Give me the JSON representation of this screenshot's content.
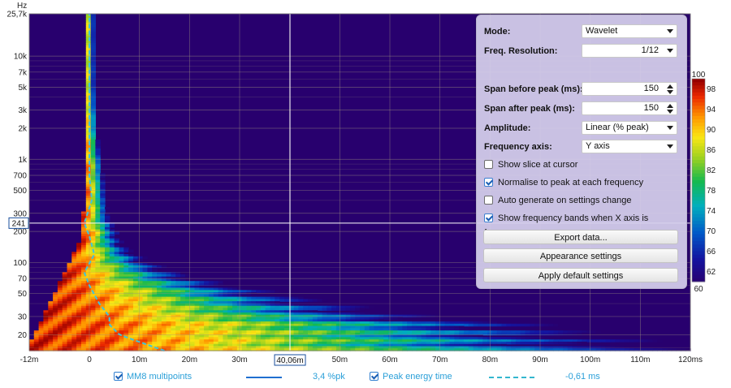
{
  "chart_data": {
    "type": "heatmap",
    "xlabel": "",
    "x_unit": "ms",
    "xlim": [
      -12,
      120
    ],
    "x_ticks": [
      "-12m",
      "0",
      "10m",
      "20m",
      "30m",
      "40m",
      "50m",
      "60m",
      "70m",
      "80m",
      "90m",
      "100m",
      "110m",
      "120ms"
    ],
    "x_tick_values": [
      -12,
      0,
      10,
      20,
      30,
      40,
      50,
      60,
      70,
      80,
      90,
      100,
      110,
      120
    ],
    "ylabel": "Hz",
    "y_scale": "log",
    "ylim": [
      14,
      25700
    ],
    "y_ticks": [
      "25,7k",
      "10k",
      "7k",
      "5k",
      "3k",
      "2k",
      "1k",
      "700",
      "500",
      "300",
      "200",
      "100",
      "70",
      "50",
      "30",
      "20"
    ],
    "y_tick_values": [
      25700,
      10000,
      7000,
      5000,
      3000,
      2000,
      1000,
      700,
      500,
      300,
      200,
      100,
      70,
      50,
      30,
      20
    ],
    "cursor": {
      "x_label": "40,06m",
      "x_value": 40.06,
      "y_label": "241",
      "y_value": 241
    },
    "colorbar": {
      "min": 60,
      "max": 100,
      "ticks": [
        100,
        98,
        94,
        90,
        86,
        82,
        78,
        74,
        70,
        66,
        62,
        60
      ]
    },
    "decay_end_ms": [
      {
        "f": 15,
        "t": 120
      },
      {
        "f": 20,
        "t": 108
      },
      {
        "f": 25,
        "t": 95
      },
      {
        "f": 30,
        "t": 70
      },
      {
        "f": 40,
        "t": 52
      },
      {
        "f": 50,
        "t": 40
      },
      {
        "f": 70,
        "t": 22
      },
      {
        "f": 100,
        "t": 12
      },
      {
        "f": 150,
        "t": 6
      },
      {
        "f": 200,
        "t": 5
      },
      {
        "f": 300,
        "t": 3
      },
      {
        "f": 500,
        "t": 2.5
      },
      {
        "f": 1000,
        "t": 1.5
      },
      {
        "f": 2000,
        "t": 0.5
      },
      {
        "f": 5000,
        "t": 0
      }
    ],
    "peak_energy_time": [
      {
        "f": 14,
        "t": 15
      },
      {
        "f": 17,
        "t": 10
      },
      {
        "f": 20,
        "t": 6
      },
      {
        "f": 25,
        "t": 4
      },
      {
        "f": 30,
        "t": 4
      },
      {
        "f": 40,
        "t": 2
      },
      {
        "f": 60,
        "t": 0
      },
      {
        "f": 80,
        "t": -1
      },
      {
        "f": 120,
        "t": 1
      },
      {
        "f": 180,
        "t": 0
      },
      {
        "f": 241,
        "t": -1
      },
      {
        "f": 400,
        "t": 0.5
      },
      {
        "f": 700,
        "t": 0
      },
      {
        "f": 1500,
        "t": 0
      },
      {
        "f": 25700,
        "t": 0
      }
    ],
    "series": [
      {
        "name": "MM8 multipoints",
        "value": "3,4 %pk",
        "color": "#1f6fd0",
        "style": "solid"
      },
      {
        "name": "Peak energy time",
        "value": "-0,61 ms",
        "color": "#33b7cf",
        "style": "dashed"
      }
    ]
  },
  "panel": {
    "mode_label": "Mode:",
    "mode_value": "Wavelet",
    "freq_res_label": "Freq. Resolution:",
    "freq_res_value": "1/12",
    "span_before_label": "Span before peak (ms):",
    "span_before_value": "150",
    "span_after_label": "Span after peak (ms):",
    "span_after_value": "150",
    "amplitude_label": "Amplitude:",
    "amplitude_value": "Linear (% peak)",
    "freq_axis_label": "Frequency axis:",
    "freq_axis_value": "Y axis",
    "chk_slice": "Show slice at cursor",
    "chk_slice_on": false,
    "chk_normalise": "Normalise to peak at each frequency",
    "chk_normalise_on": true,
    "chk_autogen": "Auto generate on settings change",
    "chk_autogen_on": false,
    "chk_bands": "Show frequency bands when X axis is frequency",
    "chk_bands_on": true,
    "export_btn": "Export data...",
    "appearance_btn": "Appearance settings",
    "defaults_btn": "Apply default settings"
  },
  "legend": {
    "series1_name": "MM8 multipoints",
    "series1_value": "3,4 %pk",
    "series2_name": "Peak energy time",
    "series2_value": "-0,61 ms"
  }
}
